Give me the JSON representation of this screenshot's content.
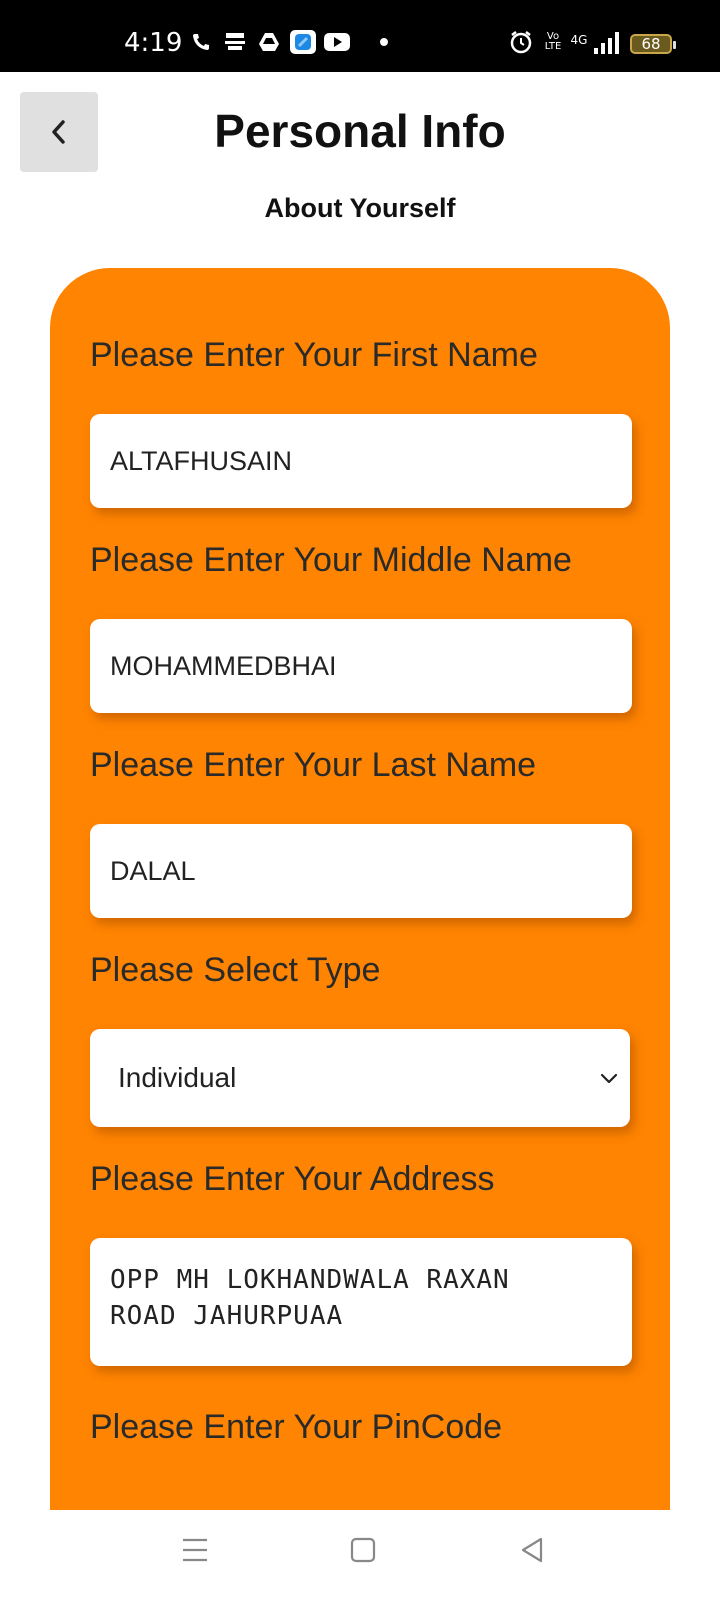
{
  "status_bar": {
    "time": "4:19",
    "battery": "68",
    "network": "4G",
    "volte": "Vo LTE",
    "icons": [
      "phone-icon",
      "app-notification-icon",
      "drive-icon",
      "app-icon",
      "youtube-icon",
      "alarm-icon",
      "signal-icon",
      "battery-icon"
    ]
  },
  "header": {
    "title": "Personal Info",
    "subtitle": "About Yourself"
  },
  "form": {
    "first_name_label": "Please Enter Your First Name",
    "first_name_value": "ALTAFHUSAIN",
    "middle_name_label": "Please Enter Your Middle Name",
    "middle_name_value": "MOHAMMEDBHAI",
    "last_name_label": "Please Enter Your Last Name",
    "last_name_value": "DALAL",
    "type_label": "Please Select Type",
    "type_value": "Individual",
    "address_label": "Please Enter Your Address",
    "address_value": "OPP MH LOKHANDWALA RAXAN\nROAD JAHURPUAA",
    "pincode_label": "Please Enter Your PinCode"
  },
  "colors": {
    "card": "#ff8401",
    "back_button": "#e0e0e0"
  }
}
